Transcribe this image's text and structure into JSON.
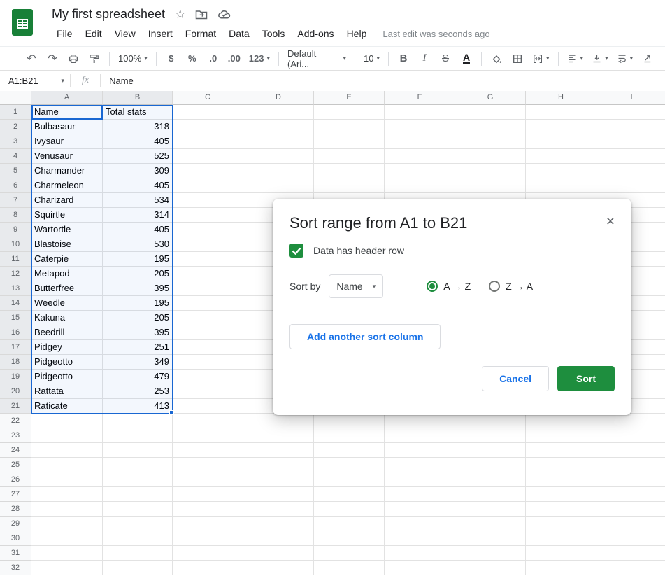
{
  "titlebar": {
    "title": "My first spreadsheet",
    "menus": [
      "File",
      "Edit",
      "View",
      "Insert",
      "Format",
      "Data",
      "Tools",
      "Add-ons",
      "Help"
    ],
    "last_edit": "Last edit was seconds ago"
  },
  "toolbar": {
    "zoom": "100%",
    "currency": "$",
    "percent": "%",
    "decrease_decimal": ".0",
    "increase_decimal": ".00",
    "more_formats": "123",
    "font": "Default (Ari...",
    "font_size": "10",
    "bold": "B",
    "italic": "I",
    "strikethrough": "S",
    "text_color": "A"
  },
  "formula_bar": {
    "name_box": "A1:B21",
    "fx": "fx",
    "value": "Name"
  },
  "grid": {
    "columns": [
      "A",
      "B",
      "C",
      "D",
      "E",
      "F",
      "G",
      "H",
      "I"
    ],
    "row_count": 32,
    "selected_columns": [
      "A",
      "B"
    ],
    "selected_row_end": 21,
    "rows": [
      [
        "Name",
        "Total stats"
      ],
      [
        "Bulbasaur",
        "318"
      ],
      [
        "Ivysaur",
        "405"
      ],
      [
        "Venusaur",
        "525"
      ],
      [
        "Charmander",
        "309"
      ],
      [
        "Charmeleon",
        "405"
      ],
      [
        "Charizard",
        "534"
      ],
      [
        "Squirtle",
        "314"
      ],
      [
        "Wartortle",
        "405"
      ],
      [
        "Blastoise",
        "530"
      ],
      [
        "Caterpie",
        "195"
      ],
      [
        "Metapod",
        "205"
      ],
      [
        "Butterfree",
        "395"
      ],
      [
        "Weedle",
        "195"
      ],
      [
        "Kakuna",
        "205"
      ],
      [
        "Beedrill",
        "395"
      ],
      [
        "Pidgey",
        "251"
      ],
      [
        "Pidgeotto",
        "349"
      ],
      [
        "Pidgeotto",
        "479"
      ],
      [
        "Rattata",
        "253"
      ],
      [
        "Raticate",
        "413"
      ]
    ]
  },
  "dialog": {
    "title": "Sort range from A1 to B21",
    "close": "×",
    "header_checkbox_label": "Data has header row",
    "sort_by_label": "Sort by",
    "sort_by_value": "Name",
    "asc_label": "A → Z",
    "desc_label": "Z → A",
    "add_column_label": "Add another sort column",
    "cancel_label": "Cancel",
    "sort_label": "Sort"
  },
  "colors": {
    "sheets_green": "#188038",
    "dialog_green": "#1e8e3e",
    "selection_blue": "#1967d2",
    "action_blue": "#1a73e8"
  }
}
